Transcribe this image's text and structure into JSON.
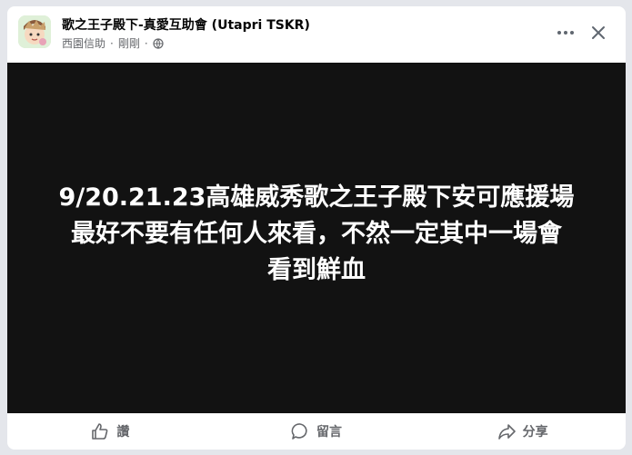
{
  "post": {
    "page_name": "歌之王子殿下-真愛互助會 (Utapri TSKR)",
    "author": "西園信助",
    "time": "剛剛",
    "privacy_icon": "globe-icon",
    "text_lines": [
      "9/20.21.23高雄威秀歌之王子殿下安可應援場",
      "最好不要有任何人來看，不然一定其中一場會",
      "看到鮮血"
    ]
  },
  "header_controls": {
    "more_icon": "more-options-icon",
    "close_icon": "close-icon"
  },
  "actions": {
    "like": "讚",
    "comment": "留言",
    "share": "分享"
  },
  "colors": {
    "card_background": "#ffffff",
    "media_background": "#121212",
    "meta_text": "#65676b",
    "title_text": "#050505"
  }
}
